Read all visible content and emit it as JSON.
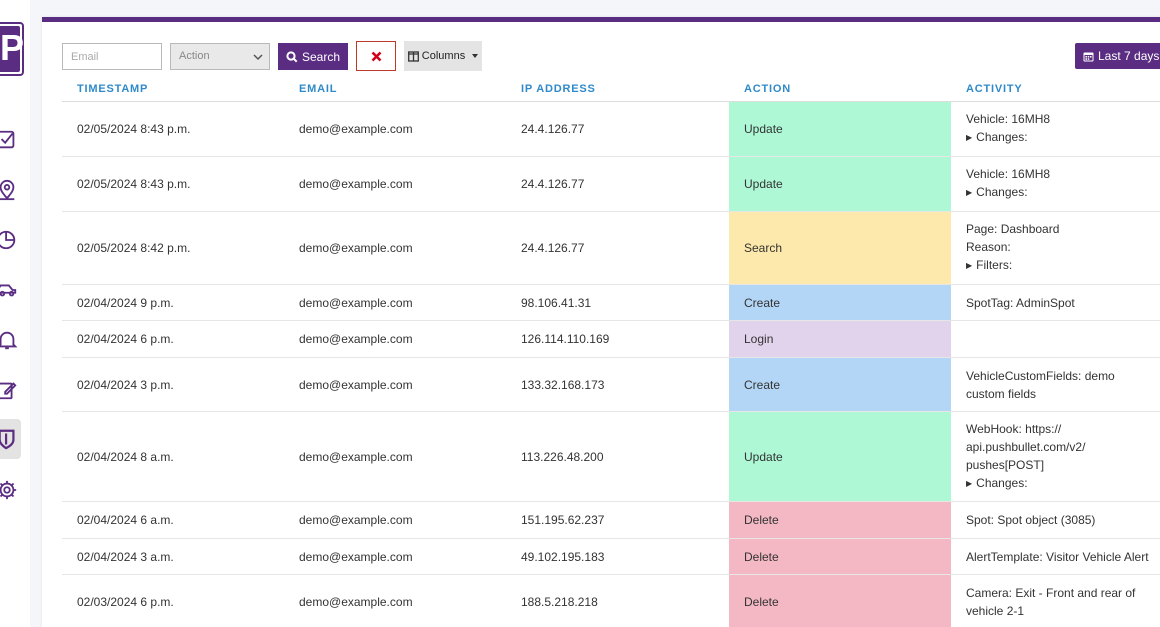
{
  "sidebar": {
    "logo_letter": "P",
    "icons": [
      "checkbox-icon",
      "location-pin-icon",
      "pie-chart-icon",
      "car-icon",
      "bell-icon",
      "edit-icon",
      "shield-icon",
      "gear-icon"
    ],
    "active_item": "shield-icon"
  },
  "toolbar": {
    "email_placeholder": "Email",
    "action_placeholder": "Action",
    "search_label": "Search",
    "columns_label": "Columns",
    "date_range_label": "Last 7 days"
  },
  "table": {
    "headers": [
      "TIMESTAMP",
      "EMAIL",
      "IP ADDRESS",
      "ACTION",
      "ACTIVITY"
    ],
    "rows": [
      {
        "timestamp": "02/05/2024 8:43 p.m.",
        "email": "demo@example.com",
        "ip": "24.4.126.77",
        "action": "Update",
        "activity": [
          "Vehicle: 16MH8"
        ],
        "details": [
          "Changes:"
        ]
      },
      {
        "timestamp": "02/05/2024 8:43 p.m.",
        "email": "demo@example.com",
        "ip": "24.4.126.77",
        "action": "Update",
        "activity": [
          "Vehicle: 16MH8"
        ],
        "details": [
          "Changes:"
        ]
      },
      {
        "timestamp": "02/05/2024 8:42 p.m.",
        "email": "demo@example.com",
        "ip": "24.4.126.77",
        "action": "Search",
        "activity": [
          "Page: Dashboard",
          "Reason:"
        ],
        "details": [
          "Filters:"
        ]
      },
      {
        "timestamp": "02/04/2024 9 p.m.",
        "email": "demo@example.com",
        "ip": "98.106.41.31",
        "action": "Create",
        "activity": [
          "SpotTag: AdminSpot"
        ],
        "details": []
      },
      {
        "timestamp": "02/04/2024 6 p.m.",
        "email": "demo@example.com",
        "ip": "126.114.110.169",
        "action": "Login",
        "activity": [],
        "details": []
      },
      {
        "timestamp": "02/04/2024 3 p.m.",
        "email": "demo@example.com",
        "ip": "133.32.168.173",
        "action": "Create",
        "activity": [
          "VehicleCustomFields: demo",
          "custom fields"
        ],
        "details": []
      },
      {
        "timestamp": "02/04/2024 8 a.m.",
        "email": "demo@example.com",
        "ip": "113.226.48.200",
        "action": "Update",
        "activity": [
          "WebHook: https://",
          "api.pushbullet.com/v2/",
          "pushes[POST]"
        ],
        "details": [
          "Changes:"
        ]
      },
      {
        "timestamp": "02/04/2024 6 a.m.",
        "email": "demo@example.com",
        "ip": "151.195.62.237",
        "action": "Delete",
        "activity": [
          "Spot: Spot object (3085)"
        ],
        "details": []
      },
      {
        "timestamp": "02/04/2024 3 a.m.",
        "email": "demo@example.com",
        "ip": "49.102.195.183",
        "action": "Delete",
        "activity": [
          "AlertTemplate: Visitor Vehicle Alert"
        ],
        "details": []
      },
      {
        "timestamp": "02/03/2024 6 p.m.",
        "email": "demo@example.com",
        "ip": "188.5.218.218",
        "action": "Delete",
        "activity": [
          "Camera: Exit - Front and rear of",
          "vehicle 2-1"
        ],
        "details": []
      }
    ]
  },
  "colors": {
    "brand": "#5b2d82",
    "header_text": "#2f8ac9",
    "update": "#aef8d6",
    "search": "#fde9ac",
    "create": "#b4d6f6",
    "login": "#e2d3ec",
    "delete": "#f3b8c4"
  }
}
